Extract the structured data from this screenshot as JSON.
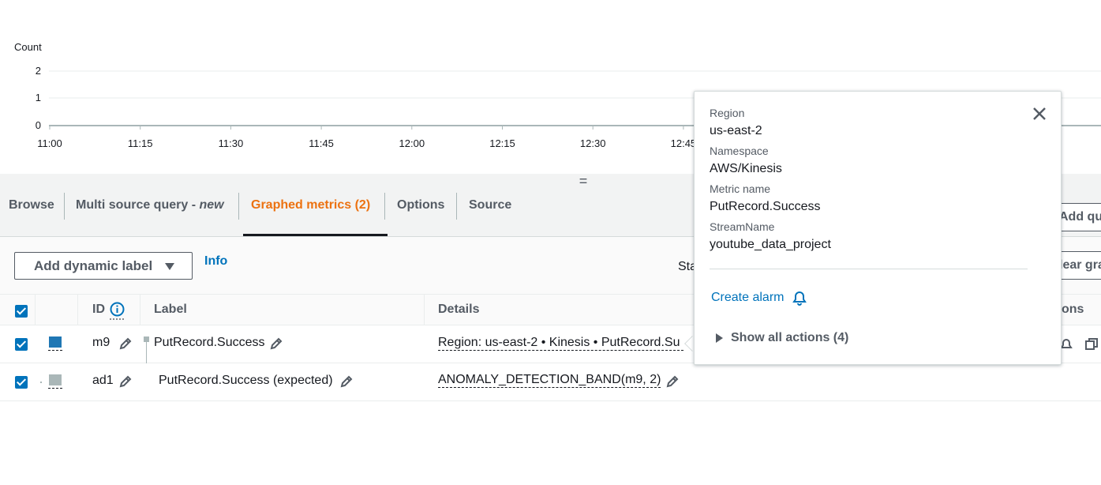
{
  "chart": {
    "y_unit": "Count",
    "y_ticks": [
      "2",
      "1",
      "0"
    ],
    "x_ticks": [
      "11:00",
      "11:15",
      "11:30",
      "11:45",
      "12:00",
      "12:15",
      "12:30",
      "12:45"
    ]
  },
  "tabs": [
    {
      "label": "Browse",
      "active": false
    },
    {
      "label": "Multi source query - ",
      "suffix": "new",
      "active": false
    },
    {
      "label": "Graphed metrics (2)",
      "active": true
    },
    {
      "label": "Options",
      "active": false
    },
    {
      "label": "Source",
      "active": false
    }
  ],
  "tab_actions": {
    "add_query": "Add qu"
  },
  "toolbar": {
    "dynamic_label_button": "Add dynamic label",
    "info_link": "Info",
    "statistic_partial": "Sta",
    "clear_graph_partial": "lear gra"
  },
  "table": {
    "headers": {
      "id": "ID",
      "label": "Label",
      "details": "Details",
      "actions_partial": "ons"
    },
    "rows": [
      {
        "id": "m9",
        "label": "PutRecord.Success",
        "details": "Region: us-east-2 • Kinesis • PutRecord.Su",
        "color": "#1f77b4",
        "checked": true
      },
      {
        "id": "ad1",
        "label": "PutRecord.Success (expected)",
        "details": "ANOMALY_DETECTION_BAND(m9, 2)",
        "color": "#aab7b8",
        "checked": true
      }
    ]
  },
  "popover": {
    "fields": [
      {
        "key": "Region",
        "value": "us-east-2"
      },
      {
        "key": "Namespace",
        "value": "AWS/Kinesis"
      },
      {
        "key": "Metric name",
        "value": "PutRecord.Success"
      },
      {
        "key": "StreamName",
        "value": "youtube_data_project"
      }
    ],
    "create_alarm": "Create alarm",
    "show_all_actions": "Show all actions (4)"
  },
  "colors": {
    "accent": "#ec7211",
    "link": "#0073bb",
    "metric_m9": "#1f77b4",
    "metric_ad1": "#aab7b8"
  }
}
